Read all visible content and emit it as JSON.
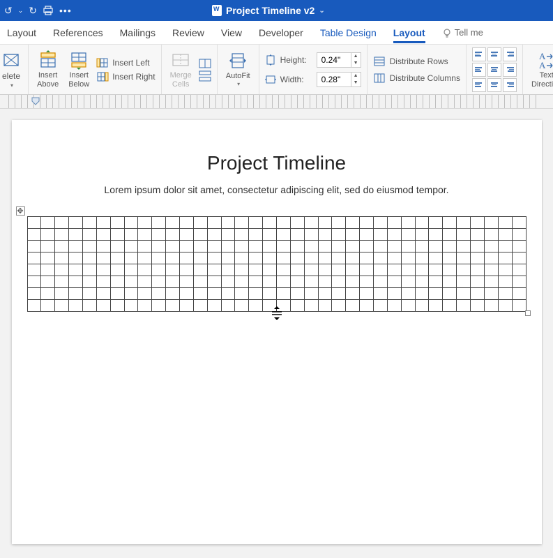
{
  "titlebar": {
    "filename": "Project Timeline v2"
  },
  "tabs": {
    "layout": "Layout",
    "references": "References",
    "mailings": "Mailings",
    "review": "Review",
    "view": "View",
    "developer": "Developer",
    "table_design": "Table Design",
    "table_layout": "Layout",
    "tell_me": "Tell me"
  },
  "ribbon": {
    "delete": "elete",
    "insert_above": "Insert\nAbove",
    "insert_below": "Insert\nBelow",
    "insert_left": "Insert Left",
    "insert_right": "Insert Right",
    "merge_cells": "Merge\nCells",
    "autofit": "AutoFit",
    "height_label": "Height:",
    "height_value": "0.24\"",
    "width_label": "Width:",
    "width_value": "0.28\"",
    "distribute_rows": "Distribute Rows",
    "distribute_columns": "Distribute Columns",
    "text_direction": "Text\nDirection"
  },
  "document": {
    "heading": "Project Timeline",
    "subtext": "Lorem ipsum dolor sit amet, consectetur adipiscing elit, sed do eiusmod tempor.",
    "table_rows": 8,
    "table_cols": 36,
    "move_handle_glyph": "✥"
  }
}
